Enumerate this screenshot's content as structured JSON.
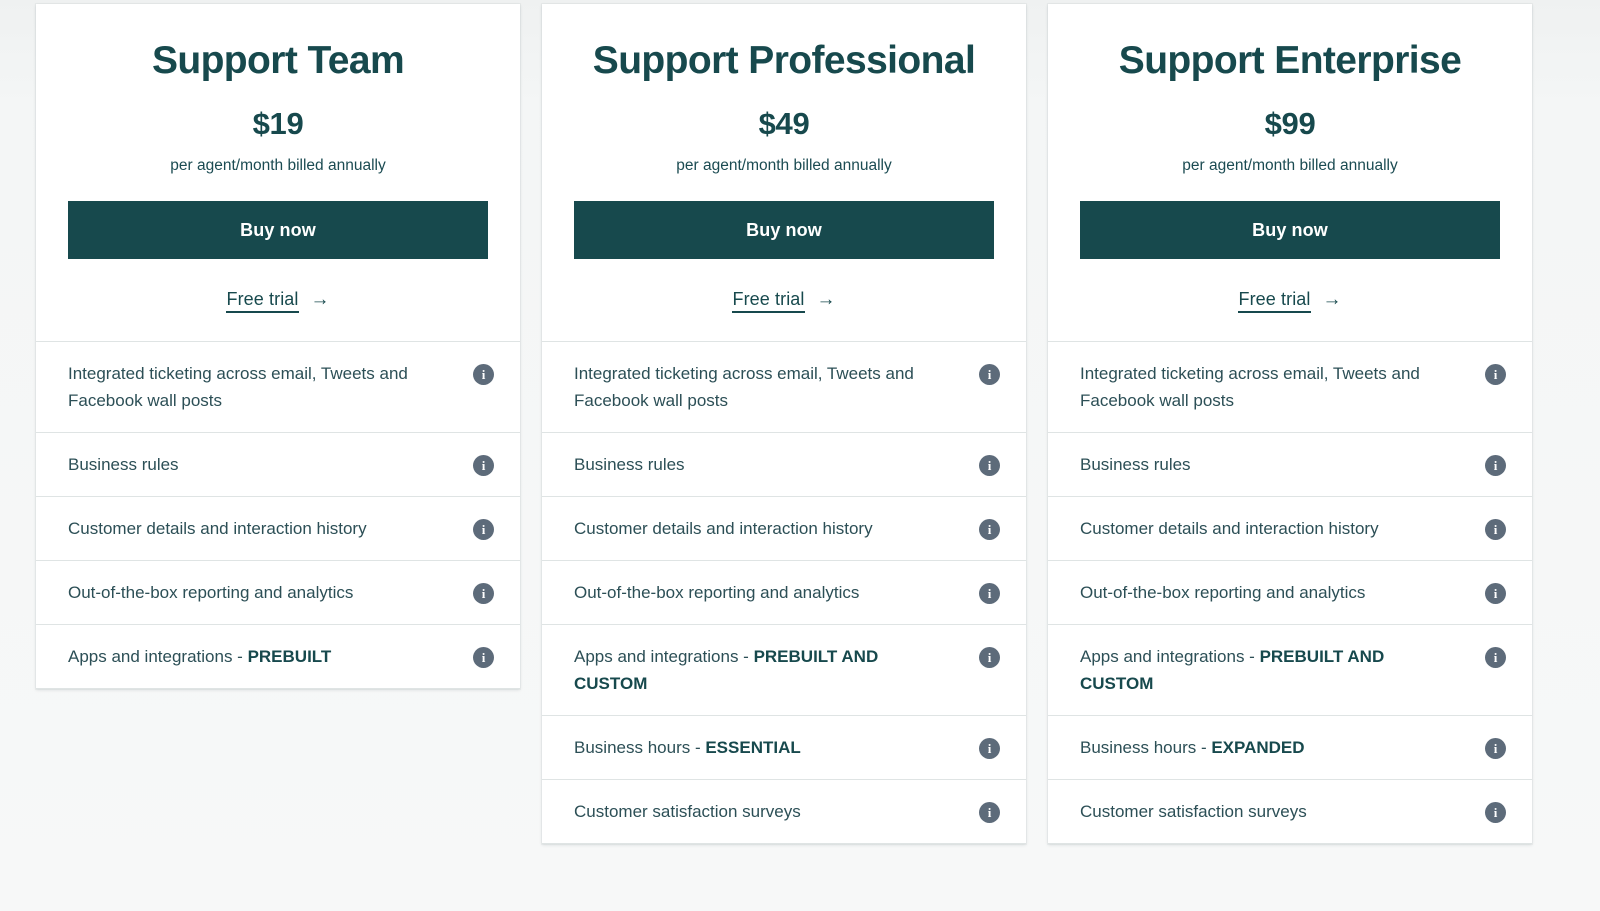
{
  "colors": {
    "brand_dark": "#17494d",
    "page_bg": "#f4f6f6",
    "card_bg": "#ffffff",
    "divider": "#dfe4e4",
    "info_icon_bg": "#5d6b7a",
    "feature_text": "#2c4f56"
  },
  "icons": {
    "info": "i",
    "arrow_right": "→"
  },
  "plans": [
    {
      "title": "Support Team",
      "price": "$19",
      "period": "per agent/month billed annually",
      "buy_label": "Buy now",
      "trial_label": "Free trial",
      "features": [
        {
          "text": "Integrated ticketing across email, Tweets and Facebook wall posts",
          "emphasis": ""
        },
        {
          "text": "Business rules",
          "emphasis": ""
        },
        {
          "text": "Customer details and interaction history",
          "emphasis": ""
        },
        {
          "text": "Out-of-the-box reporting and analytics",
          "emphasis": ""
        },
        {
          "text": "Apps and integrations - ",
          "emphasis": "PREBUILT"
        }
      ]
    },
    {
      "title": "Support Professional",
      "price": "$49",
      "period": "per agent/month billed annually",
      "buy_label": "Buy now",
      "trial_label": "Free trial",
      "features": [
        {
          "text": "Integrated ticketing across email, Tweets and Facebook wall posts",
          "emphasis": ""
        },
        {
          "text": "Business rules",
          "emphasis": ""
        },
        {
          "text": "Customer details and interaction history",
          "emphasis": ""
        },
        {
          "text": "Out-of-the-box reporting and analytics",
          "emphasis": ""
        },
        {
          "text": "Apps and integrations - ",
          "emphasis": "PREBUILT AND CUSTOM"
        },
        {
          "text": "Business hours - ",
          "emphasis": "ESSENTIAL"
        },
        {
          "text": "Customer satisfaction surveys",
          "emphasis": ""
        }
      ]
    },
    {
      "title": "Support Enterprise",
      "price": "$99",
      "period": "per agent/month billed annually",
      "buy_label": "Buy now",
      "trial_label": "Free trial",
      "features": [
        {
          "text": "Integrated ticketing across email, Tweets and Facebook wall posts",
          "emphasis": ""
        },
        {
          "text": "Business rules",
          "emphasis": ""
        },
        {
          "text": "Customer details and interaction history",
          "emphasis": ""
        },
        {
          "text": "Out-of-the-box reporting and analytics",
          "emphasis": ""
        },
        {
          "text": "Apps and integrations - ",
          "emphasis": "PREBUILT AND CUSTOM"
        },
        {
          "text": "Business hours - ",
          "emphasis": "EXPANDED"
        },
        {
          "text": "Customer satisfaction surveys",
          "emphasis": ""
        }
      ]
    }
  ]
}
